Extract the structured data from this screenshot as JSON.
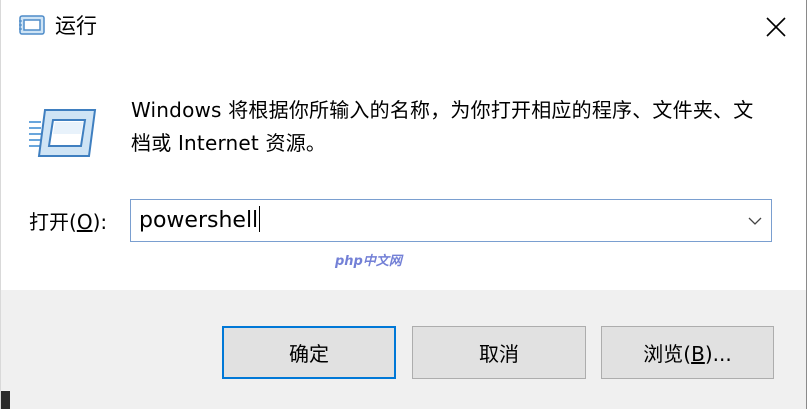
{
  "window": {
    "title": "运行",
    "close_icon": "close-icon"
  },
  "content": {
    "description": "Windows 将根据你所输入的名称，为你打开相应的程序、文件夹、文档或 Internet 资源。",
    "open_label_prefix": "打开(",
    "open_label_hotkey": "O",
    "open_label_suffix": "):",
    "input_value": "powershell",
    "watermark": "php中文网"
  },
  "buttons": {
    "ok": "确定",
    "cancel": "取消",
    "browse_prefix": "浏览(",
    "browse_hotkey": "B",
    "browse_suffix": ")..."
  },
  "colors": {
    "accent_border": "#0078d7",
    "input_border": "#7a9fd0",
    "footer_bg": "#f0f0f0",
    "button_bg": "#e1e1e1"
  }
}
